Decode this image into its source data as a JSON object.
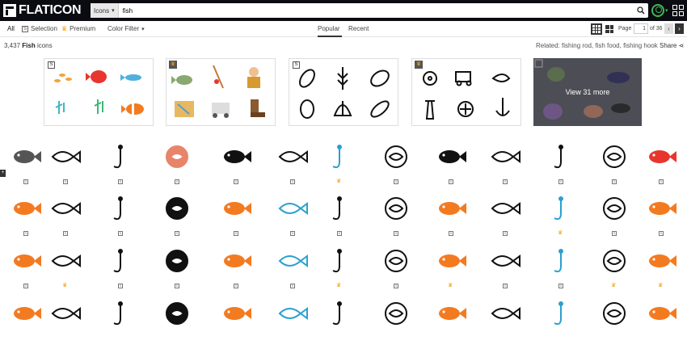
{
  "topbar": {
    "logo_text": "FLATICON",
    "type_select": "Icons",
    "search_value": "fish"
  },
  "filters": {
    "all": "All",
    "selection": "Selection",
    "premium": "Premium",
    "color_filter": "Color Filter",
    "popular": "Popular",
    "recent": "Recent",
    "page_label": "Page",
    "page_value": "1",
    "page_total": "of 36"
  },
  "info": {
    "count": "3,437",
    "count_term": "Fish",
    "count_suffix": "icons",
    "related": "Related: fishing rod, fish food, fishing hook",
    "share": "Share"
  },
  "packs": {
    "badges": [
      "S",
      "",
      "S",
      "",
      ""
    ],
    "view_more": "View 31 more"
  },
  "colors": {
    "brand_dark": "#0b0b12",
    "premium": "#f4a10c",
    "user_green": "#3cba54"
  },
  "icon_grid": [
    [
      "S",
      "S",
      "S",
      "S",
      "S",
      "S",
      "P",
      "S",
      "S",
      "S",
      "S",
      "S",
      "S"
    ],
    [
      "S",
      "S",
      "S",
      "S",
      "S",
      "S",
      "S",
      "S",
      "S",
      "S",
      "P",
      "S",
      "S"
    ],
    [
      "S",
      "P",
      "S",
      "S",
      "S",
      "S",
      "P",
      "S",
      "P",
      "S",
      "S",
      "P",
      "P"
    ],
    [
      "S",
      "S",
      "S",
      "S",
      "S",
      "S",
      "S",
      "S",
      "S",
      "S",
      "S",
      "S",
      "S"
    ]
  ]
}
